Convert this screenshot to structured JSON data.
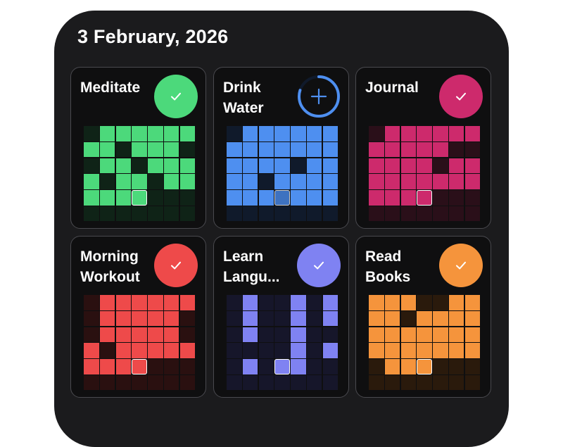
{
  "header": {
    "date": "3 February, 2026"
  },
  "habits": [
    {
      "name": "Meditate",
      "status": "done",
      "color": "#4cd97b",
      "dim": "#0f2317",
      "button_icon": "check-icon",
      "grid": [
        "0111111",
        "1101110",
        "0110111",
        "1011011",
        "1110000",
        "0000000"
      ]
    },
    {
      "name": "Drink\nWater",
      "status": "in-progress",
      "progress": 0.8,
      "color": "#4e8ff0",
      "dim": "#101a2b",
      "button_icon": "plus-icon",
      "grid": [
        "0111111",
        "1111111",
        "1111011",
        "1101111",
        "1111111",
        "0000000"
      ]
    },
    {
      "name": "Journal",
      "status": "done",
      "color": "#cd2a6c",
      "dim": "#2a0f19",
      "button_icon": "check-icon",
      "grid": [
        "0111111",
        "1111100",
        "1111011",
        "1111111",
        "1111000",
        "0000000"
      ]
    },
    {
      "name": "Morning\nWorkout",
      "status": "done",
      "color": "#ee4a4a",
      "dim": "#2a1010",
      "button_icon": "check-icon",
      "grid": [
        "0111111",
        "0111110",
        "0111110",
        "1011111",
        "1111000",
        "0000000"
      ]
    },
    {
      "name": "Learn\nLangu...",
      "status": "done",
      "color": "#7f82f2",
      "dim": "#16162a",
      "button_icon": "check-icon",
      "grid": [
        "0100101",
        "0100101",
        "0100100",
        "0000101",
        "0100100",
        "0000000"
      ]
    },
    {
      "name": "Read\nBooks",
      "status": "done",
      "color": "#f5943c",
      "dim": "#2a1a0c",
      "button_icon": "check-icon",
      "grid": [
        "1110011",
        "1101111",
        "1111111",
        "1111111",
        "0111000",
        "0000000"
      ]
    }
  ],
  "today_cell": {
    "row": 4,
    "col": 3
  }
}
